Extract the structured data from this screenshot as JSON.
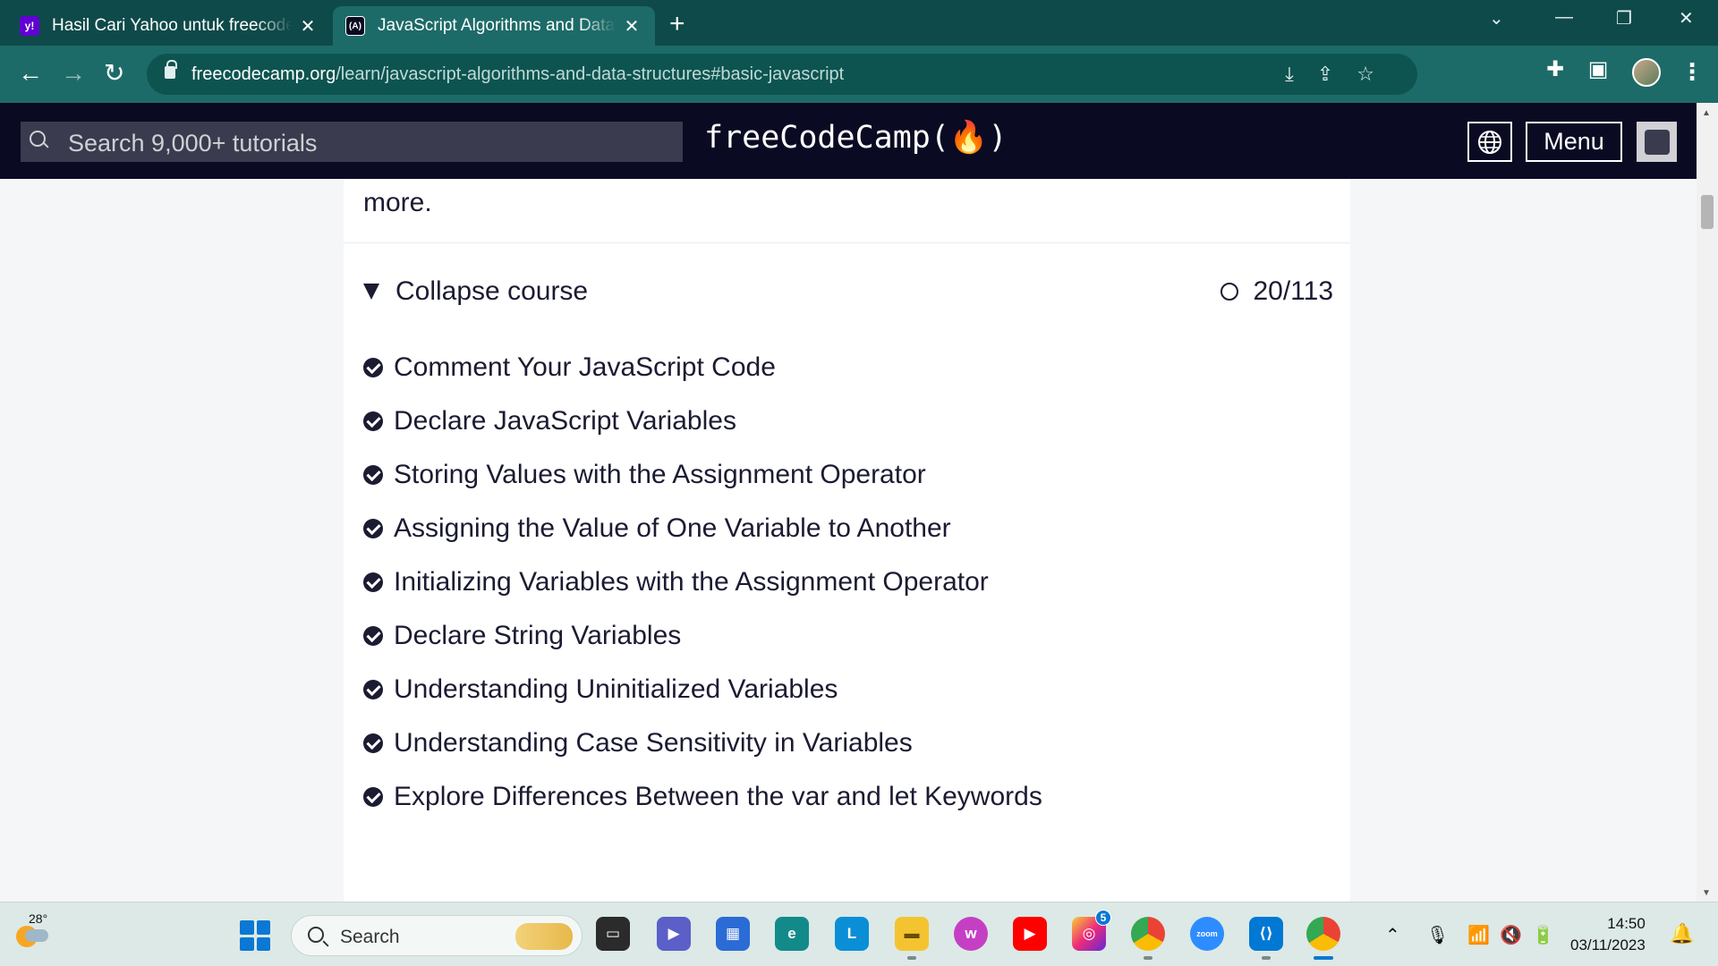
{
  "browser": {
    "tabs": [
      {
        "title": "Hasil Cari Yahoo untuk freecodecamp",
        "favicon": "yahoo-icon",
        "favicon_text": "y!"
      },
      {
        "title": "JavaScript Algorithms and Data Structures",
        "favicon": "freecodecamp-icon",
        "favicon_text": "(A)"
      }
    ],
    "new_tab_label": "+",
    "address": {
      "host": "freecodecamp.org",
      "path": "/learn/javascript-algorithms-and-data-structures#basic-javascript"
    }
  },
  "site_nav": {
    "search_placeholder": "Search 9,000+ tutorials",
    "logo": "freeCodeCamp(🔥)",
    "menu_label": "Menu"
  },
  "content": {
    "intro_tail": "more.",
    "collapse_label": "Collapse course",
    "progress": "20/113",
    "lessons": [
      "Comment Your JavaScript Code",
      "Declare JavaScript Variables",
      "Storing Values with the Assignment Operator",
      "Assigning the Value of One Variable to Another",
      "Initializing Variables with the Assignment Operator",
      "Declare String Variables",
      "Understanding Uninitialized Variables",
      "Understanding Case Sensitivity in Variables",
      "Explore Differences Between the var and let Keywords"
    ]
  },
  "taskbar": {
    "temperature": "28°",
    "search_label": "Search",
    "instagram_badge": "5",
    "zoom_label": "zoom",
    "time": "14:50",
    "date": "03/11/2023"
  },
  "colors": {
    "chrome_tabbar": "#0f4a4a",
    "chrome_toolbar": "#1d6b68",
    "fcc_nav": "#0a0a23",
    "fcc_text": "#1b1b32"
  }
}
